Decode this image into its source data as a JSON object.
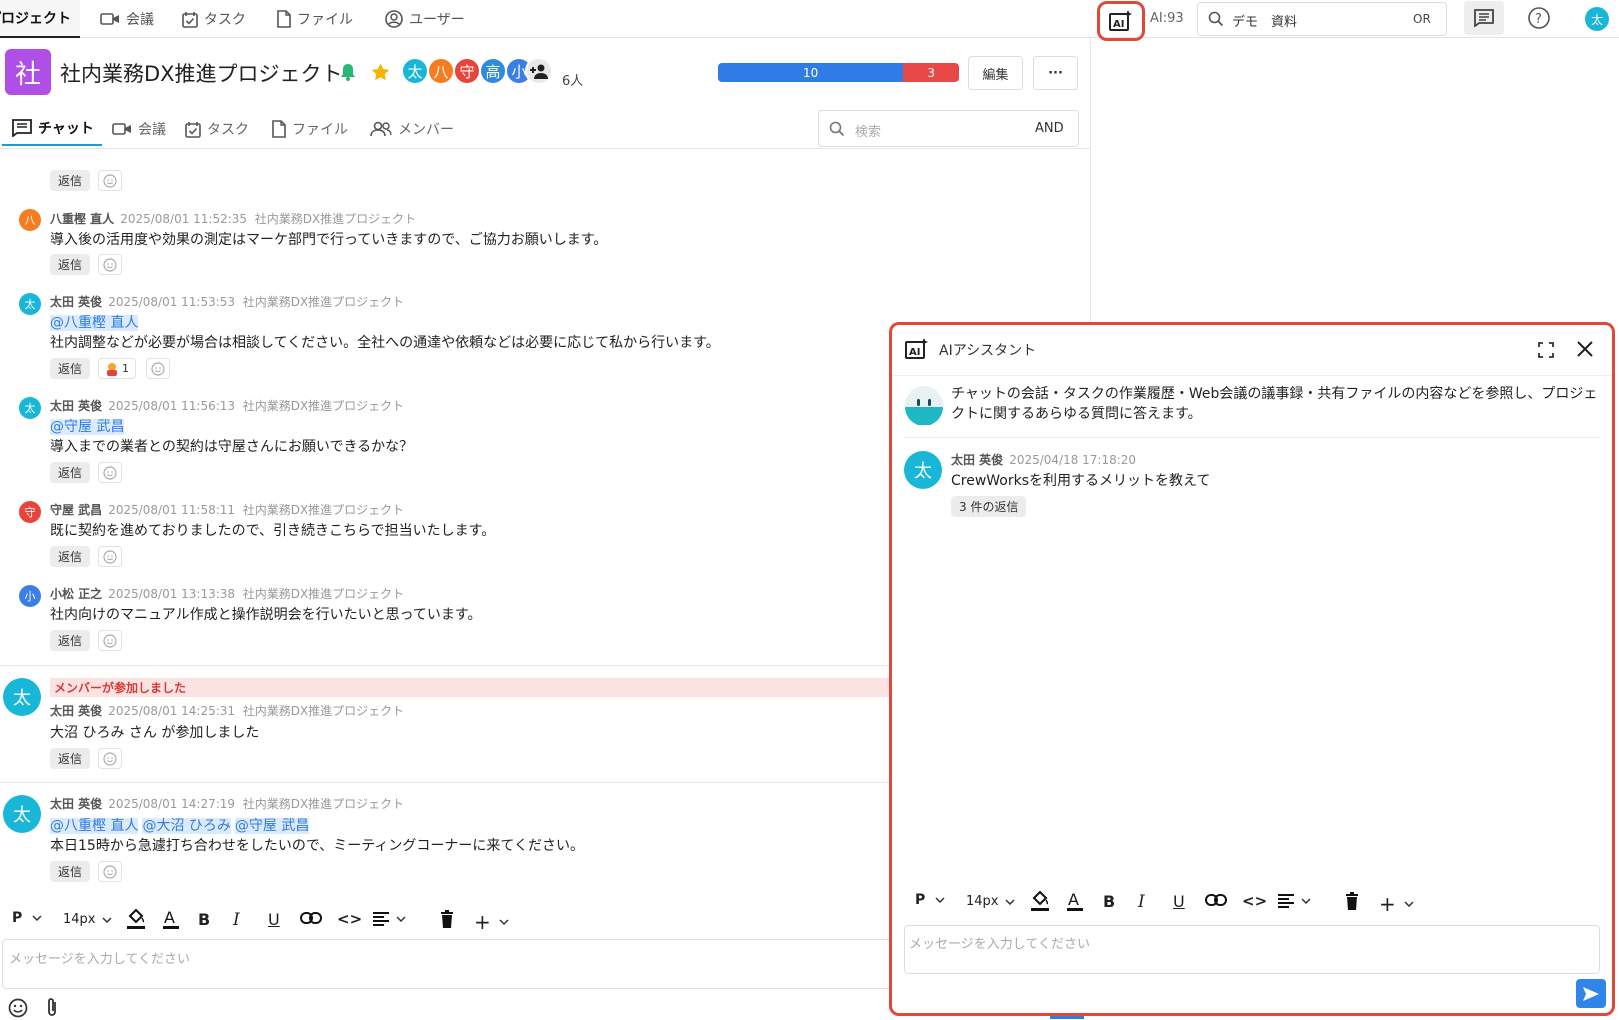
{
  "topnav": {
    "tabs": [
      {
        "label": "プロジェクト",
        "icon": "folder-icon"
      },
      {
        "label": "会議",
        "icon": "video-icon"
      },
      {
        "label": "タスク",
        "icon": "task-check-icon"
      },
      {
        "label": "ファイル",
        "icon": "file-icon"
      },
      {
        "label": "ユーザー",
        "icon": "user-circle-icon"
      }
    ],
    "ai_count": "AI:93",
    "search_value": "デモ　資料",
    "search_mode": "OR",
    "user_avatar": "太"
  },
  "project": {
    "icon_char": "社",
    "title": "社内業務DX推進プロジェクト",
    "members": [
      {
        "char": "太",
        "color": "#18b7d8"
      },
      {
        "char": "八",
        "color": "#f57c1f"
      },
      {
        "char": "守",
        "color": "#e8443b"
      },
      {
        "char": "高",
        "color": "#2f8be0"
      },
      {
        "char": "小",
        "color": "#3b7fe6"
      }
    ],
    "member_count": "6人",
    "progress": {
      "done": 10,
      "todo": 3,
      "done_color": "#2f7ce6",
      "todo_color": "#e94848"
    },
    "edit_label": "編集",
    "more_label": "···"
  },
  "subtabs": [
    {
      "label": "チャット",
      "icon": "chat-icon"
    },
    {
      "label": "会議",
      "icon": "video-icon"
    },
    {
      "label": "タスク",
      "icon": "task-check-icon"
    },
    {
      "label": "ファイル",
      "icon": "file-icon"
    },
    {
      "label": "メンバー",
      "icon": "members-icon"
    }
  ],
  "chat_search": {
    "placeholder": "検索",
    "mode": "AND"
  },
  "messages": [
    {
      "avatar": "八",
      "color": "#f57c1f",
      "name": "八重樫 直人",
      "time": "2025/08/01 11:52:35",
      "project": "社内業務DX推進プロジェクト",
      "text": "導入後の活用度や効果の測定はマーケ部門で行っていきますので、ご協力お願いします。"
    },
    {
      "avatar": "太",
      "color": "#18b7d8",
      "name": "太田 英俊",
      "time": "2025/08/01 11:53:53",
      "project": "社内業務DX推進プロジェクト",
      "mentions": [
        "@八重樫 直人"
      ],
      "text": "社内調整などが必要が場合は相談してください。全社への通達や依頼などは必要に応じて私から行います。",
      "reaction_count": "1"
    },
    {
      "avatar": "太",
      "color": "#18b7d8",
      "name": "太田 英俊",
      "time": "2025/08/01 11:56:13",
      "project": "社内業務DX推進プロジェクト",
      "mentions": [
        "@守屋 武昌"
      ],
      "text": "導入までの業者との契約は守屋さんにお願いできるかな？"
    },
    {
      "avatar": "守",
      "color": "#e8443b",
      "name": "守屋 武昌",
      "time": "2025/08/01 11:58:11",
      "project": "社内業務DX推進プロジェクト",
      "text": "既に契約を進めておりましたので、引き続きこちらで担当いたします。"
    },
    {
      "avatar": "小",
      "color": "#3b7fe6",
      "name": "小松 正之",
      "time": "2025/08/01 13:13:38",
      "project": "社内業務DX推進プロジェクト",
      "text": "社内向けのマニュアル作成と操作説明会を行いたいと思っています。"
    },
    {
      "avatar": "太",
      "color": "#18b7d8",
      "name": "太田 英俊",
      "time": "2025/08/01 14:25:31",
      "project": "社内業務DX推進プロジェクト",
      "system": "メンバーが参加しました",
      "text": "大沼 ひろみ さん が参加しました"
    },
    {
      "avatar": "太",
      "color": "#18b7d8",
      "name": "太田 英俊",
      "time": "2025/08/01 14:27:19",
      "project": "社内業務DX推進プロジェクト",
      "mentions": [
        "@八重樫 直人",
        "@大沼 ひろみ",
        "@守屋 武昌"
      ],
      "text": "本日15時から急遽打ち合わせをしたいので、ミーティングコーナーに来てください。"
    }
  ],
  "reply_label": "返信",
  "editor": {
    "paragraph": "P",
    "font_size": "14px",
    "placeholder": "メッセージを入力してください"
  },
  "ai_panel": {
    "title": "AIアシスタント",
    "intro": "チャットの会話・タスクの作業履歴・Web会議の議事録・共有ファイルの内容などを参照し、プロジェクトに関するあらゆる質問に答えます。",
    "intro_line1": "チャットの会話・タスクの作業履歴・Web会議の議事録・共有ファイルの内容などを参照し、プロジェ",
    "intro_line2": "クトに関するあらゆる質問に答えます。",
    "message": {
      "avatar": "太",
      "name": "太田 英俊",
      "time": "2025/04/18 17:18:20",
      "text": "CrewWorksを利用するメリットを教えて",
      "replies": "3 件の返信"
    },
    "paragraph": "P",
    "font_size": "14px",
    "placeholder": "メッセージを入力してください"
  }
}
